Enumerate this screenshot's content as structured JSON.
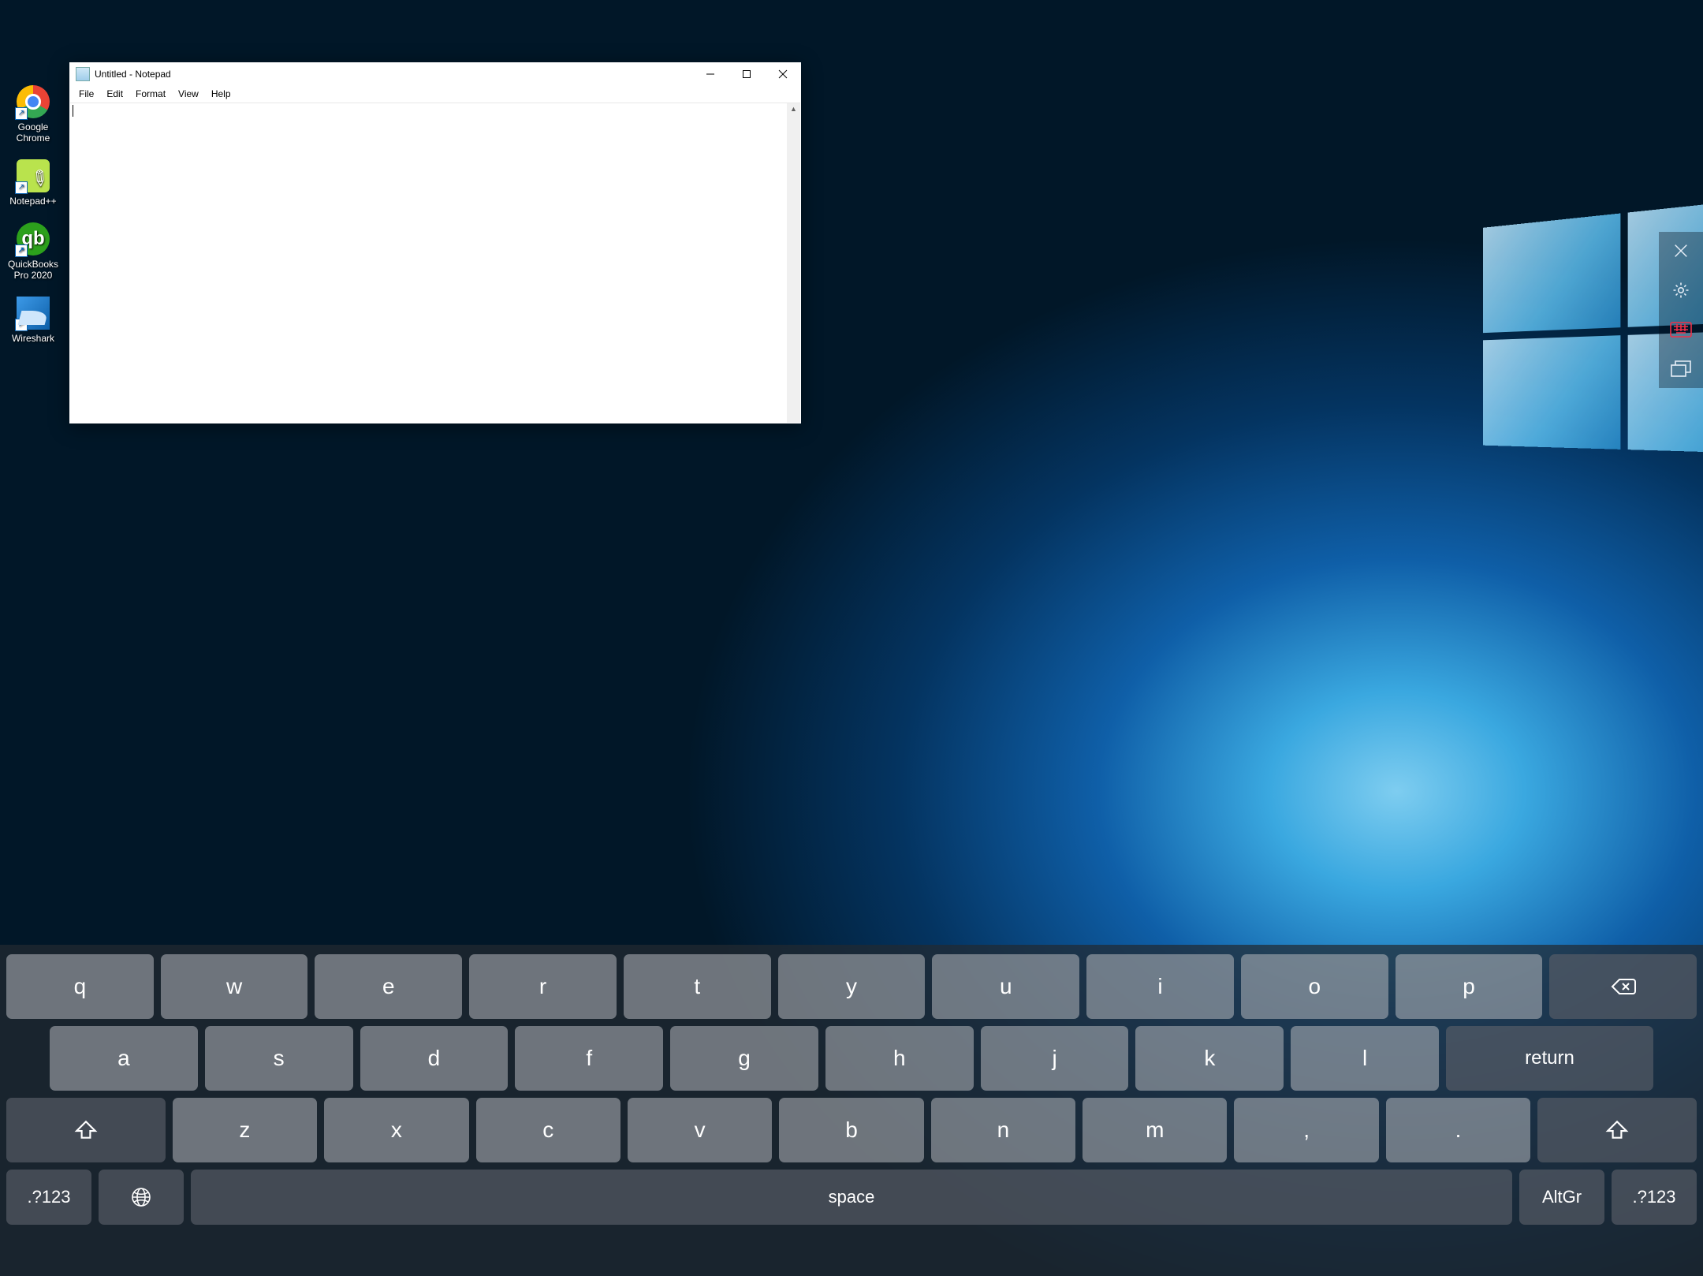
{
  "desktop": {
    "icons": [
      {
        "label": "Google\nChrome",
        "name": "chrome"
      },
      {
        "label": "Notepad++",
        "name": "notepadpp"
      },
      {
        "label": "QuickBooks\nPro 2020",
        "name": "quickbooks"
      },
      {
        "label": "Wireshark",
        "name": "wireshark"
      }
    ]
  },
  "notepad": {
    "title": "Untitled - Notepad",
    "menus": [
      "File",
      "Edit",
      "Format",
      "View",
      "Help"
    ],
    "content": ""
  },
  "sidepanel": {
    "items": [
      "close",
      "settings",
      "keyboard",
      "multiwindow"
    ]
  },
  "keyboard": {
    "row1": [
      "q",
      "w",
      "e",
      "r",
      "t",
      "y",
      "u",
      "i",
      "o",
      "p"
    ],
    "row2": [
      "a",
      "s",
      "d",
      "f",
      "g",
      "h",
      "j",
      "k",
      "l"
    ],
    "returnLabel": "return",
    "row3": [
      "z",
      "x",
      "c",
      "v",
      "b",
      "n",
      "m",
      ",",
      "."
    ],
    "modeLabel": ".?123",
    "spaceLabel": "space",
    "altgrLabel": "AltGr"
  }
}
